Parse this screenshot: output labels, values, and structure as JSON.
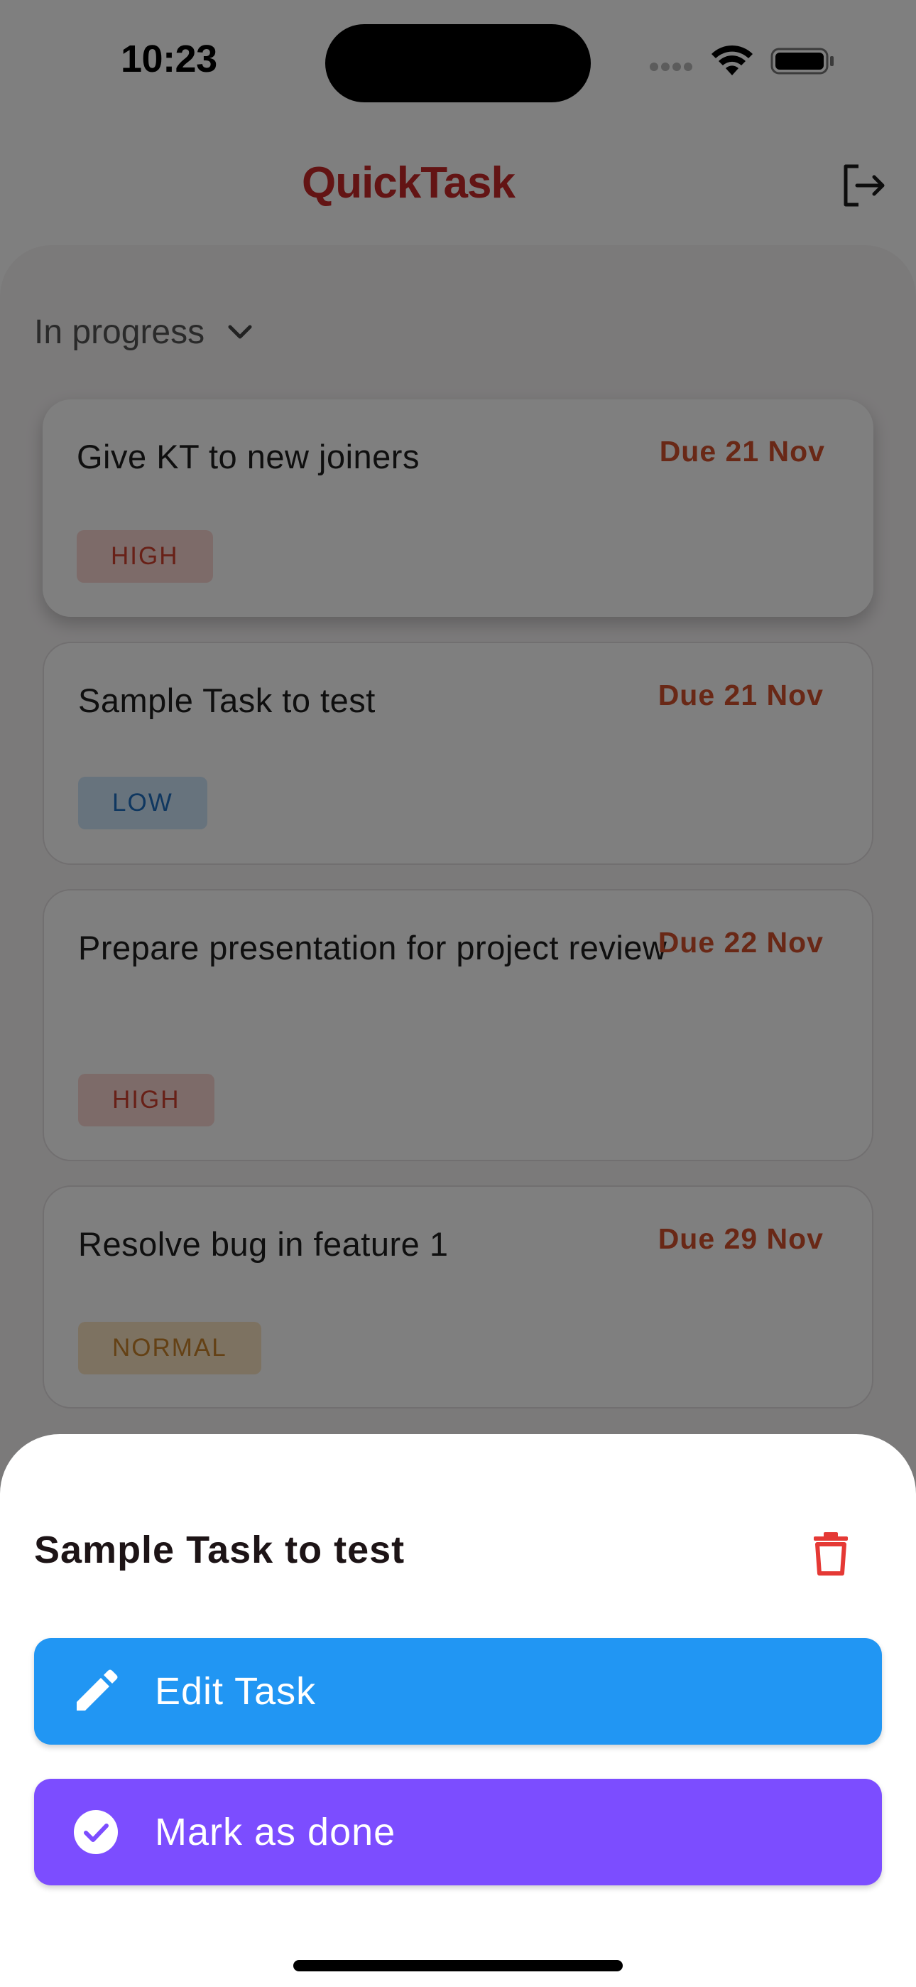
{
  "status_bar": {
    "time": "10:23"
  },
  "header": {
    "app_title": "QuickTask"
  },
  "filter": {
    "label": "In progress"
  },
  "tasks": [
    {
      "title": "Give KT to new joiners",
      "due": "Due 21 Nov",
      "priority": "HIGH"
    },
    {
      "title": "Sample Task to test",
      "due": "Due 21 Nov",
      "priority": "LOW"
    },
    {
      "title": "Prepare presentation for project review",
      "due": "Due 22 Nov",
      "priority": "HIGH"
    },
    {
      "title": "Resolve bug in feature 1",
      "due": "Due 29 Nov",
      "priority": "NORMAL"
    }
  ],
  "sheet": {
    "title": "Sample Task to test",
    "edit_label": "Edit Task",
    "done_label": "Mark as done"
  },
  "colors": {
    "brand": "#c62828",
    "due": "#d2502c",
    "edit": "#2196f3",
    "done": "#7c4dff",
    "delete": "#e53935"
  },
  "icons": {
    "logout": "logout-icon",
    "filter": "chevron-down-icon",
    "delete": "trash-icon",
    "edit": "pencil-icon",
    "done": "check-circle-icon"
  }
}
